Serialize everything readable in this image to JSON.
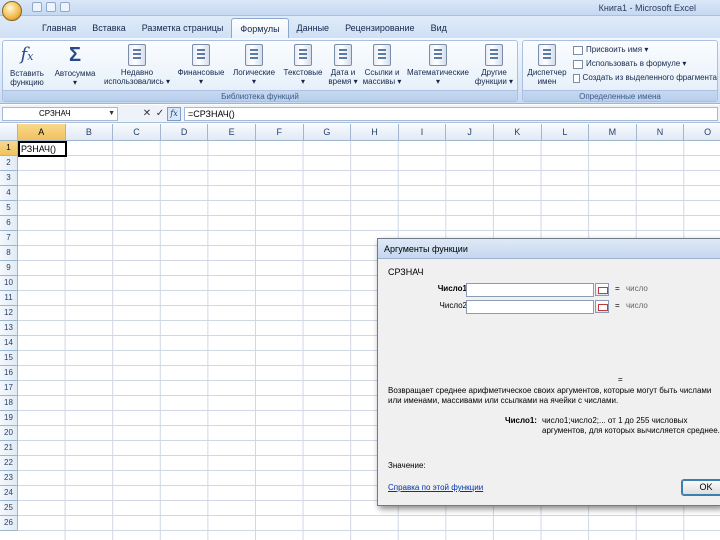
{
  "window": {
    "title": "Книга1 - Microsoft Excel"
  },
  "tabs": [
    "Главная",
    "Вставка",
    "Разметка страницы",
    "Формулы",
    "Данные",
    "Рецензирование",
    "Вид"
  ],
  "active_tab": "Формулы",
  "ribbon": {
    "insert_function": {
      "line1": "Вставить",
      "line2": "функцию"
    },
    "autosum": {
      "line1": "Автосумма",
      "line2": "▾"
    },
    "recent": {
      "line1": "Недавно",
      "line2": "использовались ▾"
    },
    "financial": {
      "line1": "Финансовые",
      "line2": "▾"
    },
    "logical": {
      "line1": "Логические",
      "line2": "▾"
    },
    "text": {
      "line1": "Текстовые",
      "line2": "▾"
    },
    "datetime": {
      "line1": "Дата и",
      "line2": "время ▾"
    },
    "lookup": {
      "line1": "Ссылки и",
      "line2": "массивы ▾"
    },
    "math": {
      "line1": "Математические",
      "line2": "▾"
    },
    "more": {
      "line1": "Другие",
      "line2": "функции ▾"
    },
    "library_label": "Библиотека функций",
    "name_manager": {
      "line1": "Диспетчер",
      "line2": "имен"
    },
    "assign_name": "Присвоить имя ▾",
    "use_in_formula": "Использовать в формуле ▾",
    "create_from_selection": "Создать из выделенного фрагмента",
    "defined_names_label": "Определенные имена"
  },
  "formula_bar": {
    "name_box": "СРЗНАЧ",
    "cancel": "✕",
    "enter": "✓",
    "fx": "fx",
    "formula": "=СРЗНАЧ()"
  },
  "grid": {
    "columns": [
      "A",
      "B",
      "C",
      "D",
      "E",
      "F",
      "G",
      "H",
      "I",
      "J",
      "K",
      "L",
      "M",
      "N",
      "O"
    ],
    "rows": [
      "1",
      "2",
      "3",
      "4",
      "5",
      "6",
      "7",
      "8",
      "9",
      "10",
      "11",
      "12",
      "13",
      "14",
      "15",
      "16",
      "17",
      "18",
      "19",
      "20",
      "21",
      "22",
      "23",
      "24",
      "25",
      "26"
    ],
    "active_cell_text": "РЗНАЧ()"
  },
  "dialog": {
    "title": "Аргументы функции",
    "function_name": "СРЗНАЧ",
    "args": [
      {
        "label": "Число1",
        "equals": "=",
        "hint": "число"
      },
      {
        "label": "Число2",
        "equals": "=",
        "hint": "число"
      }
    ],
    "result_eq": "=",
    "description": "Возвращает среднее арифметическое своих аргументов, которые могут быть числами или именами, массивами или ссылками на ячейки с числами.",
    "arg_name": "Число1:",
    "arg_description": "число1;число2;... от 1 до 255 числовых аргументов, для которых вычисляется среднее.",
    "result_label": "Значение:",
    "help_link": "Справка по этой функции",
    "ok": "OK"
  }
}
